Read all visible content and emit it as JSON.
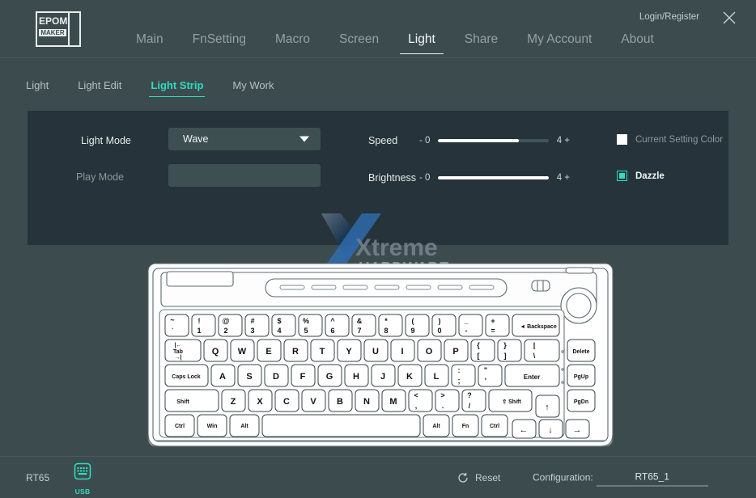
{
  "window": {
    "logo_line1": "EPOM",
    "logo_line2": "MAKER",
    "login_label": "Login/Register",
    "close_icon": "close-icon"
  },
  "main_nav": {
    "items": [
      {
        "label": "Main",
        "active": false
      },
      {
        "label": "FnSetting",
        "active": false
      },
      {
        "label": "Macro",
        "active": false
      },
      {
        "label": "Screen",
        "active": false
      },
      {
        "label": "Light",
        "active": true
      },
      {
        "label": "Share",
        "active": false
      },
      {
        "label": "My Account",
        "active": false
      },
      {
        "label": "About",
        "active": false
      }
    ]
  },
  "sub_nav": {
    "items": [
      {
        "label": "Light",
        "active": false
      },
      {
        "label": "Light Edit",
        "active": false
      },
      {
        "label": "Light Strip",
        "active": true
      },
      {
        "label": "My Work",
        "active": false
      }
    ]
  },
  "panel": {
    "light_mode": {
      "label": "Light Mode",
      "value": "Wave",
      "caret_icon": "chevron-down-icon",
      "enabled": true
    },
    "play_mode": {
      "label": "Play Mode",
      "value": "",
      "enabled": false
    },
    "speed": {
      "label": "Speed",
      "min_label": "- 0",
      "max_label": "4 +",
      "min": 0,
      "max": 4,
      "value": 3,
      "fill_percent": 73
    },
    "brightness": {
      "label": "Brightness",
      "min_label": "- 0",
      "max_label": "4 +",
      "min": 0,
      "max": 4,
      "value": 4,
      "fill_percent": 100
    },
    "current_setting_color": {
      "label": "Current Setting Color",
      "checked": false
    },
    "dazzle": {
      "label": "Dazzle",
      "checked": true
    }
  },
  "watermark": {
    "line1": "Xtreme",
    "line2": "HARDWARE"
  },
  "keyboard": {
    "model": "RT65",
    "rows": [
      [
        "~\n`",
        "!\n1",
        "@\n2",
        "#\n3",
        "$\n4",
        "%\n5",
        "^\n6",
        "&\n7",
        "*\n8",
        "(\n9",
        ")\n0",
        "_\n-",
        "+\n=",
        "Backspace"
      ],
      [
        "Tab",
        "Q",
        "W",
        "E",
        "R",
        "T",
        "Y",
        "U",
        "I",
        "O",
        "P",
        "{\n[",
        "}\n]",
        "|\n\\",
        "Delete"
      ],
      [
        "Caps Lock",
        "A",
        "S",
        "D",
        "F",
        "G",
        "H",
        "J",
        "K",
        "L",
        ":\n;",
        "\"\n'",
        "Enter",
        "PgUp"
      ],
      [
        "Shift",
        "Z",
        "X",
        "C",
        "V",
        "B",
        "N",
        "M",
        "<\n,",
        ">\n.",
        "?\n/",
        "Shift",
        "↑",
        "PgDn"
      ],
      [
        "Ctrl",
        "Win",
        "Alt",
        "",
        "Alt",
        "Fn",
        "Ctrl",
        "←",
        "↓",
        "→"
      ]
    ]
  },
  "status_bar": {
    "device_name": "RT65",
    "usb_icon": "keyboard-usb-icon",
    "usb_label": "USB",
    "reset_icon": "refresh-icon",
    "reset_label": "Reset",
    "configuration_label": "Configuration:",
    "configuration_value": "RT65_1"
  },
  "colors": {
    "page_bg": "#3c4b4e",
    "panel_bg": "#26333a",
    "field_bg": "#3e4f52",
    "accent": "#2fdcc0",
    "text": "#e4ecec",
    "text_dim": "#8c9a9a",
    "slider_fill": "#ffffff",
    "slider_track": "#42545a"
  }
}
